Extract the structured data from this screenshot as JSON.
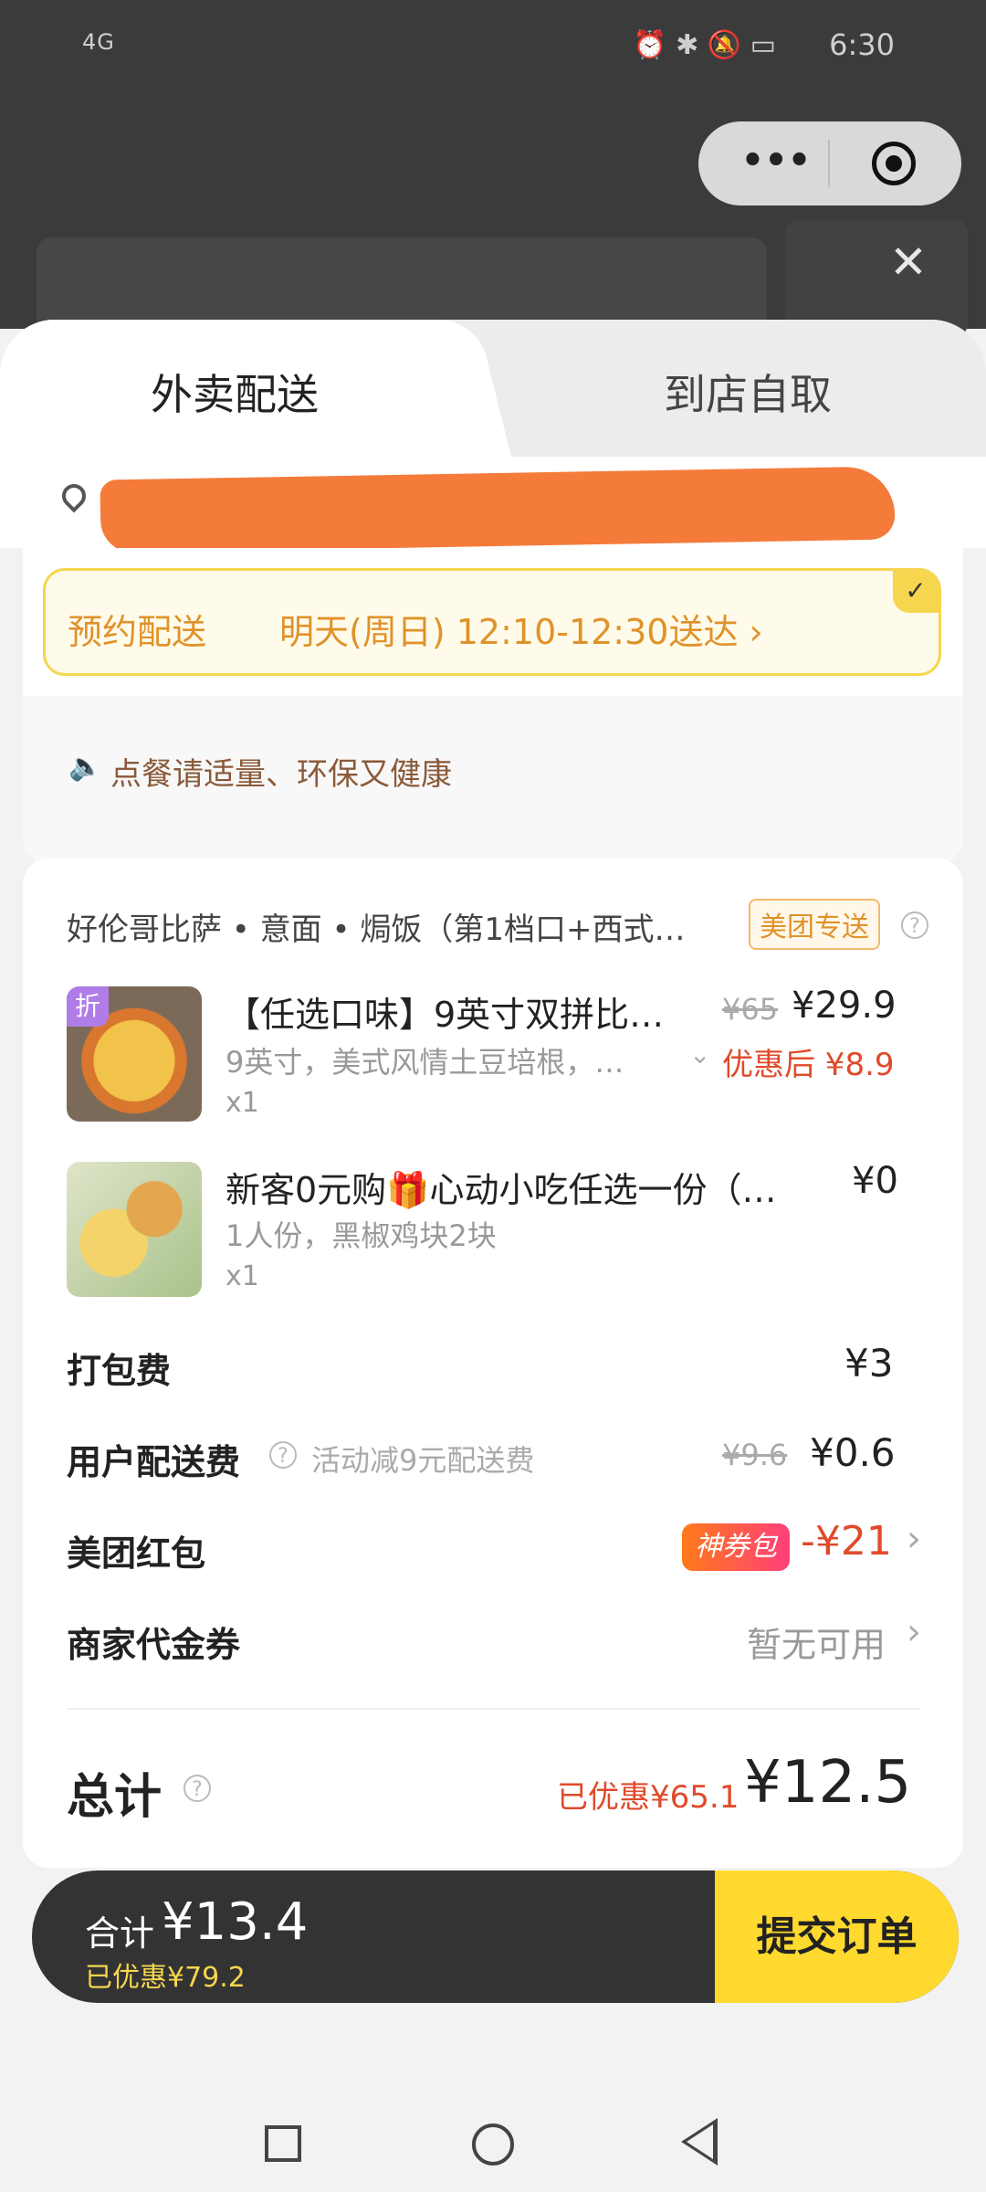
{
  "status_bar": {
    "signal": "4G",
    "status_icons": "⏰ ✱ 🔕 ▭",
    "time": "6:30"
  },
  "capsule": {
    "more": "•••"
  },
  "close": "✕",
  "tabs": [
    {
      "label": "外卖配送",
      "active": true
    },
    {
      "label": "到店自取",
      "active": false
    }
  ],
  "reservation": {
    "label": "预约配送",
    "time": "明天(周日) 12:10-12:30送达 ›",
    "check": "✓"
  },
  "tip": {
    "icon": "speaker-icon",
    "text": "点餐请适量、环保又健康"
  },
  "shop": {
    "name": "好伦哥比萨 • 意面 • 焗饭（第1档口+西式…",
    "badge": "美团专送",
    "help": "?"
  },
  "items": [
    {
      "tag": "折",
      "title": "【任选口味】9英寸双拼比…",
      "spec": "9英寸，美式风情土豆培根，…",
      "qty": "x1",
      "old_price": "¥65",
      "price": "¥29.9",
      "discount_price": "优惠后 ¥8.9",
      "chevron": "⌄"
    },
    {
      "title": "新客0元购🎁心动小吃任选一份（…",
      "spec": "1人份，黑椒鸡块2块",
      "qty": "x1",
      "price": "¥0"
    }
  ],
  "fees": {
    "packing": {
      "label": "打包费",
      "value": "¥3"
    },
    "delivery": {
      "label": "用户配送费",
      "help": "?",
      "note": "活动减9元配送费",
      "old_price": "¥9.6",
      "value": "¥0.6"
    },
    "red_packet": {
      "label": "美团红包",
      "badge": "神券包",
      "value": "-¥21",
      "chevron": "›"
    },
    "merchant_voucher": {
      "label": "商家代金券",
      "value": "暂无可用",
      "chevron": "›"
    }
  },
  "total": {
    "label": "总计",
    "help": "?",
    "saved": "已优惠¥65.1",
    "amount": "¥12.5"
  },
  "bottom_bar": {
    "label": "合计",
    "amount": "¥13.4",
    "saved": "已优惠¥79.2",
    "submit": "提交订单"
  }
}
